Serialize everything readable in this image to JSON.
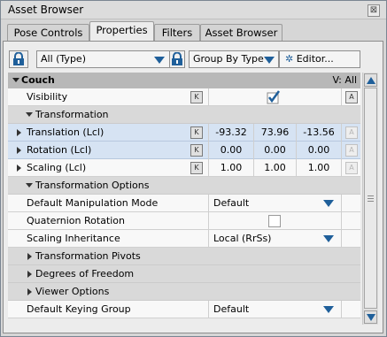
{
  "window": {
    "title": "Asset Browser",
    "close_glyph": "⊠"
  },
  "tabs": [
    {
      "label": "Pose Controls"
    },
    {
      "label": "Properties",
      "active": true
    },
    {
      "label": "Filters"
    },
    {
      "label": "Asset Browser"
    }
  ],
  "toolbar": {
    "type_filter": "All (Type)",
    "group_by": "Group By Type",
    "editor_label": "Editor..."
  },
  "grid": {
    "header": {
      "label": "Couch",
      "v_label": "V: All"
    },
    "visibility": {
      "label": "Visibility",
      "checked": true,
      "key": "K",
      "anim": "A"
    },
    "transformation": {
      "label": "Transformation"
    },
    "translation": {
      "label": "Translation (Lcl)",
      "x": "-93.32",
      "y": "73.96",
      "z": "-13.56",
      "key": "K",
      "anim": "A"
    },
    "rotation": {
      "label": "Rotation (Lcl)",
      "x": "0.00",
      "y": "0.00",
      "z": "0.00",
      "key": "K",
      "anim": "A"
    },
    "scaling": {
      "label": "Scaling (Lcl)",
      "x": "1.00",
      "y": "1.00",
      "z": "1.00",
      "key": "K",
      "anim": "A"
    },
    "transformation_options": {
      "label": "Transformation Options"
    },
    "manipulation_mode": {
      "label": "Default Manipulation Mode",
      "value": "Default"
    },
    "quaternion": {
      "label": "Quaternion Rotation",
      "checked": false
    },
    "scaling_inheritance": {
      "label": "Scaling Inheritance",
      "value": "Local (RrSs)"
    },
    "pivots": {
      "label": "Transformation Pivots"
    },
    "dof": {
      "label": "Degrees of Freedom"
    },
    "viewer": {
      "label": "Viewer Options"
    },
    "keying_group": {
      "label": "Default Keying Group",
      "value": "Default"
    }
  },
  "colors": {
    "accent": "#1f5f9a",
    "selected_row": "#d6e3f3",
    "header_row": "#b8b8b8"
  }
}
